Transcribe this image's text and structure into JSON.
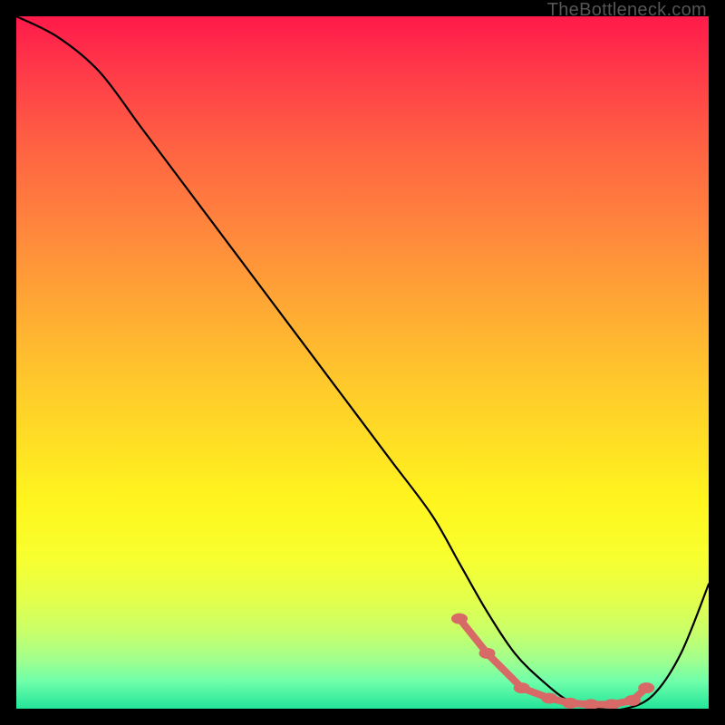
{
  "watermark": "TheBottleneck.com",
  "chart_data": {
    "type": "line",
    "title": "",
    "xlabel": "",
    "ylabel": "",
    "xlim": [
      0,
      100
    ],
    "ylim": [
      0,
      100
    ],
    "series": [
      {
        "name": "bottleneck-curve",
        "x": [
          0,
          6,
          12,
          18,
          24,
          30,
          36,
          42,
          48,
          54,
          60,
          64,
          68,
          72,
          76,
          80,
          84,
          88,
          92,
          96,
          100
        ],
        "y": [
          100,
          97,
          92,
          84,
          76,
          68,
          60,
          52,
          44,
          36,
          28,
          21,
          14,
          8,
          4,
          1,
          0,
          0,
          2,
          8,
          18
        ]
      }
    ],
    "markers": {
      "name": "highlight-dots",
      "color": "#d76a66",
      "points_x": [
        64,
        68,
        73,
        77,
        80,
        83,
        86,
        89,
        91
      ],
      "points_y": [
        13,
        8,
        3,
        1.5,
        0.8,
        0.6,
        0.6,
        1.2,
        3
      ]
    },
    "gradient_stops": [
      {
        "pos": 0.0,
        "color": "#ff1a4a"
      },
      {
        "pos": 0.5,
        "color": "#ffd028"
      },
      {
        "pos": 0.8,
        "color": "#faff30"
      },
      {
        "pos": 1.0,
        "color": "#23e59a"
      }
    ]
  }
}
